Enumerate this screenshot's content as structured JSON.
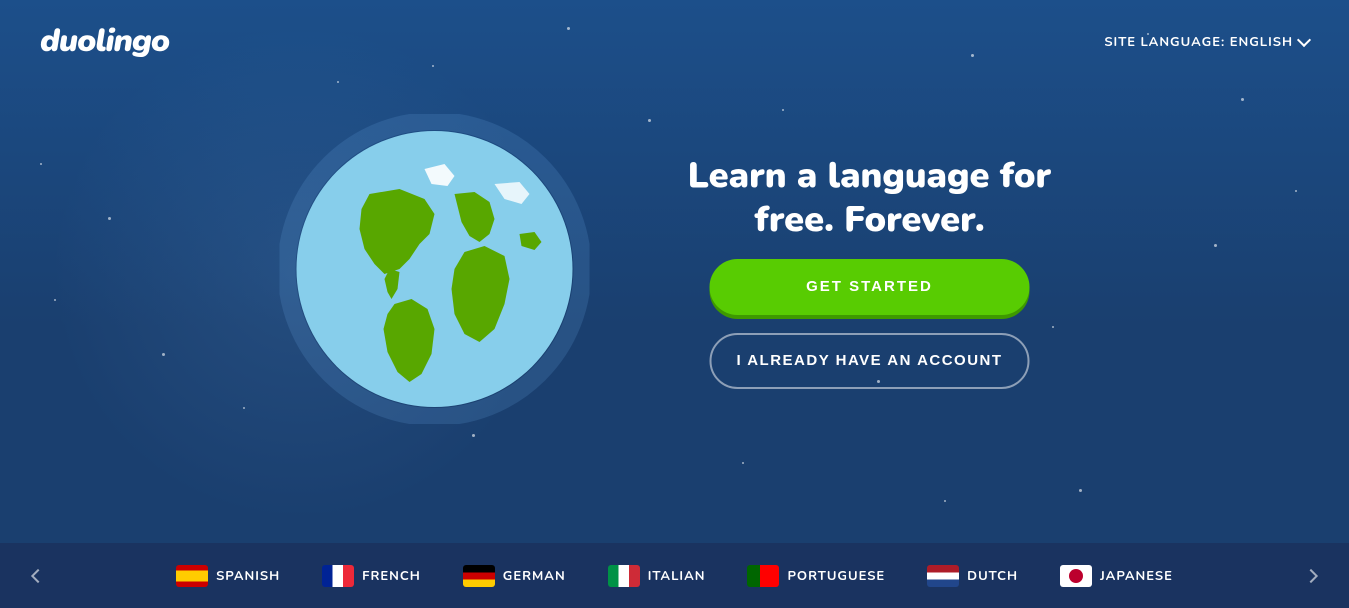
{
  "header": {
    "logo": "duolingo",
    "site_language_label": "SITE LANGUAGE: ENGLISH",
    "chevron_icon": "chevron-down-icon"
  },
  "hero": {
    "tagline": "Learn a language for free. Forever.",
    "get_started_label": "GET STARTED",
    "account_label": "I ALREADY HAVE AN ACCOUNT"
  },
  "language_bar": {
    "prev_label": "<",
    "next_label": ">",
    "languages": [
      {
        "code": "es",
        "label": "SPANISH",
        "flag_class": "flag-es"
      },
      {
        "code": "fr",
        "label": "FRENCH",
        "flag_class": "flag-fr"
      },
      {
        "code": "de",
        "label": "GERMAN",
        "flag_class": "flag-de"
      },
      {
        "code": "it",
        "label": "ITALIAN",
        "flag_class": "flag-it"
      },
      {
        "code": "pt",
        "label": "PORTUGUESE",
        "flag_class": "flag-pt"
      },
      {
        "code": "nl",
        "label": "DUTCH",
        "flag_class": "flag-nl"
      },
      {
        "code": "ja",
        "label": "JAPANESE",
        "flag_class": "flag-jp"
      }
    ]
  },
  "colors": {
    "bg_main": "#1a3f6f",
    "bg_bar": "#1a3360",
    "green_btn": "#58cc02",
    "green_shadow": "#3e9900",
    "white": "#ffffff"
  }
}
